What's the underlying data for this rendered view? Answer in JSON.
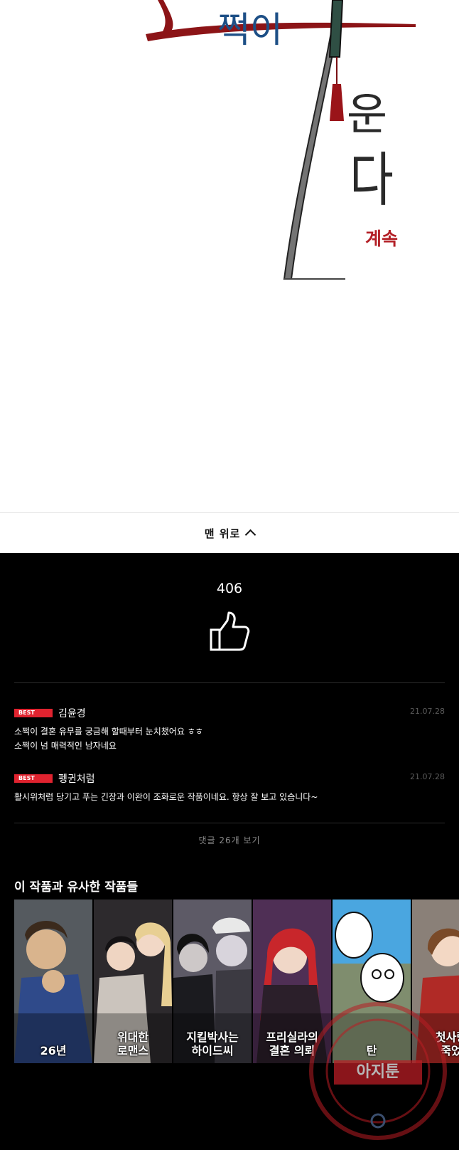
{
  "comic": {
    "title_glyphs": [
      "쩍이",
      "운",
      "다"
    ],
    "continued": "계속"
  },
  "nav": {
    "back_to_top": "맨 위로"
  },
  "likes": {
    "count": "406",
    "icon": "thumbs-up-icon"
  },
  "comments": [
    {
      "badge": "BEST",
      "user": "김윤경",
      "date": "21.07.28",
      "lines": [
        "소쩍이 결혼 유무를 궁금해 할때부터 눈치챘어요 ㅎㅎ",
        "소쩍이 넘 매력적인 남자네요"
      ]
    },
    {
      "badge": "BEST",
      "user": "펭귄처럼",
      "date": "21.07.28",
      "lines": [
        "활시위처럼 당기고 푸는 긴장과 이완이 조화로운 작품이네요. 항상 잘 보고 있습니다~"
      ]
    }
  ],
  "more_comments": "댓글 26개 보기",
  "similar": {
    "title": "이 작품과 유사한 작품들",
    "items": [
      {
        "title": "26년",
        "bg": "#6a6e72"
      },
      {
        "title": "위대한\n로맨스",
        "bg": "#3c3a3e"
      },
      {
        "title": "지킬박사는\n하이드씨",
        "bg": "#4a4753"
      },
      {
        "title": "프리실라의\n결혼 의뢰",
        "bg": "#5a3a5c"
      },
      {
        "title": "탄",
        "bg": "#4aa6e0"
      },
      {
        "title": "첫사랑\n죽었",
        "bg": "#8a7c70"
      }
    ]
  },
  "watermark": {
    "text": "아지툰"
  },
  "colors": {
    "accent": "#e0232f",
    "background": "#000000"
  }
}
